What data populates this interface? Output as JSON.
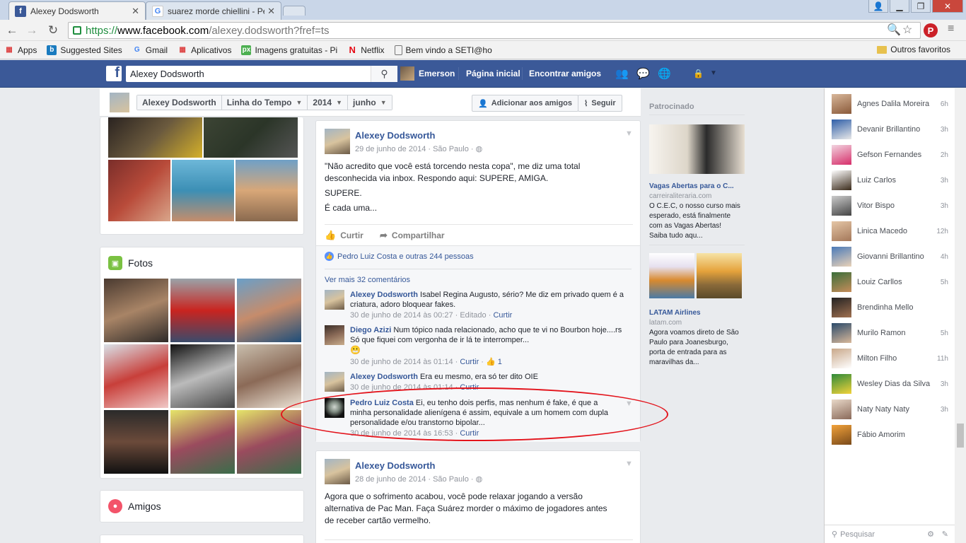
{
  "browser": {
    "tabs": [
      {
        "label": "Alexey Dodsworth",
        "icon": "facebook-icon",
        "active": true
      },
      {
        "label": "suarez morde chiellini - Pe",
        "icon": "google-icon",
        "active": false
      }
    ],
    "url": {
      "https": "https://",
      "host": "www.facebook.com",
      "path": "/alexey.dodsworth?fref=ts"
    },
    "bookmarks": [
      {
        "label": "Apps",
        "icon": "apps-grid-icon"
      },
      {
        "label": "Suggested Sites",
        "icon": "bing-icon"
      },
      {
        "label": "Gmail",
        "icon": "google-icon"
      },
      {
        "label": "Aplicativos",
        "icon": "apps-grid-icon"
      },
      {
        "label": "Imagens gratuitas - Pi",
        "icon": "pixabay-icon"
      },
      {
        "label": "Netflix",
        "icon": "netflix-icon"
      },
      {
        "label": "Bem vindo a SETI@ho",
        "icon": "page-icon"
      }
    ],
    "other_bookmarks": "Outros favoritos"
  },
  "fb": {
    "search_value": "Alexey Dodsworth",
    "user_name": "Emerson",
    "nav_home": "Página inicial",
    "nav_find_friends": "Encontrar amigos"
  },
  "timeline_bar": {
    "crumbs": [
      "Alexey Dodsworth",
      "Linha do Tempo",
      "2014",
      "junho"
    ],
    "add_friend": "Adicionar aos amigos",
    "follow": "Seguir"
  },
  "left": {
    "photos_title": "Fotos",
    "friends_title": "Amigos"
  },
  "post1": {
    "author": "Alexey Dodsworth",
    "meta": "29 de junho de 2014 · São Paulo ·",
    "lines": [
      "\"Não acredito que você está torcendo nesta copa\", me diz uma total",
      "desconhecida via inbox. Respondo aqui: SUPERE, AMIGA.",
      "SUPERE.",
      "É cada uma..."
    ],
    "like_label": "Curtir",
    "share_label": "Compartilhar",
    "likes_summary": "Pedro Luiz Costa e outras 244 pessoas",
    "more_comments": "Ver mais 32 comentários",
    "comments": [
      {
        "name": "Alexey Dodsworth",
        "text": "Isabel Regina Augusto, sério? Me diz em privado quem é a criatura, adoro bloquear fakes.",
        "meta": "30 de junho de 2014 às 00:27 · Editado ·",
        "action": "Curtir",
        "likes": ""
      },
      {
        "name": "Diego Azizi",
        "text": "Num tópico nada relacionado, acho que te vi no Bourbon hoje....rs Só que fiquei com vergonha de ir lá te interromper...",
        "meta": "30 de junho de 2014 às 01:14 ·",
        "action": "Curtir",
        "likes": "1"
      },
      {
        "name": "Alexey Dodsworth",
        "text": "Era eu mesmo, era só ter dito OIE",
        "meta": "30 de junho de 2014 às 01:14 ·",
        "action": "Curtir",
        "likes": ""
      },
      {
        "name": "Pedro Luiz Costa",
        "text": "Ei, eu tenho dois perfis, mas nenhum é fake, é que a minha personalidade alienígena é assim, equivale a um homem com dupla personalidade e/ou transtorno bipolar...",
        "meta": "30 de junho de 2014 às 16:53 ·",
        "action": "Curtir",
        "likes": ""
      }
    ]
  },
  "post2": {
    "author": "Alexey Dodsworth",
    "meta": "28 de junho de 2014 · São Paulo ·",
    "lines": [
      "Agora que o sofrimento acabou, você pode relaxar jogando a versão",
      "alternativa de Pac Man. Faça Suárez morder o máximo de jogadores antes",
      "de receber cartão vermelho."
    ]
  },
  "ads": {
    "title": "Patrocinado",
    "ad1": {
      "title": "Vagas Abertas para o C...",
      "host": "carreiraliteraria.com",
      "lines": [
        "O C.E.C, o nosso curso mais",
        "esperado, está finalmente",
        "com as Vagas Abertas!",
        "Saiba tudo aqu..."
      ]
    },
    "ad2": {
      "title": "LATAM Airlines",
      "host": "latam.com",
      "lines": [
        "Agora voamos direto de São",
        "Paulo para Joanesburgo,",
        "porta de entrada para as",
        "maravilhas da..."
      ]
    }
  },
  "chat": {
    "friends": [
      {
        "name": "Agnes Dalila Moreira",
        "time": "6h"
      },
      {
        "name": "Devanir Brillantino",
        "time": "3h"
      },
      {
        "name": "Gefson Fernandes",
        "time": "2h"
      },
      {
        "name": "Luiz Carlos",
        "time": "3h"
      },
      {
        "name": "Vitor Bispo",
        "time": "3h"
      },
      {
        "name": "Linica Macedo",
        "time": "12h"
      },
      {
        "name": "Giovanni Brillantino",
        "time": "4h"
      },
      {
        "name": "Louiz Carllos",
        "time": "5h"
      },
      {
        "name": "Brendinha Mello",
        "time": ""
      },
      {
        "name": "Murilo Ramon",
        "time": "5h"
      },
      {
        "name": "Milton Filho",
        "time": "11h"
      },
      {
        "name": "Wesley Dias da Silva",
        "time": "3h"
      },
      {
        "name": "Naty Naty Naty",
        "time": "3h"
      },
      {
        "name": "Fábio Amorim",
        "time": ""
      }
    ],
    "search_placeholder": "Pesquisar"
  },
  "colors": {
    "fb_blue": "#3b5998",
    "link": "#365899",
    "annotation": "#e3131b"
  }
}
